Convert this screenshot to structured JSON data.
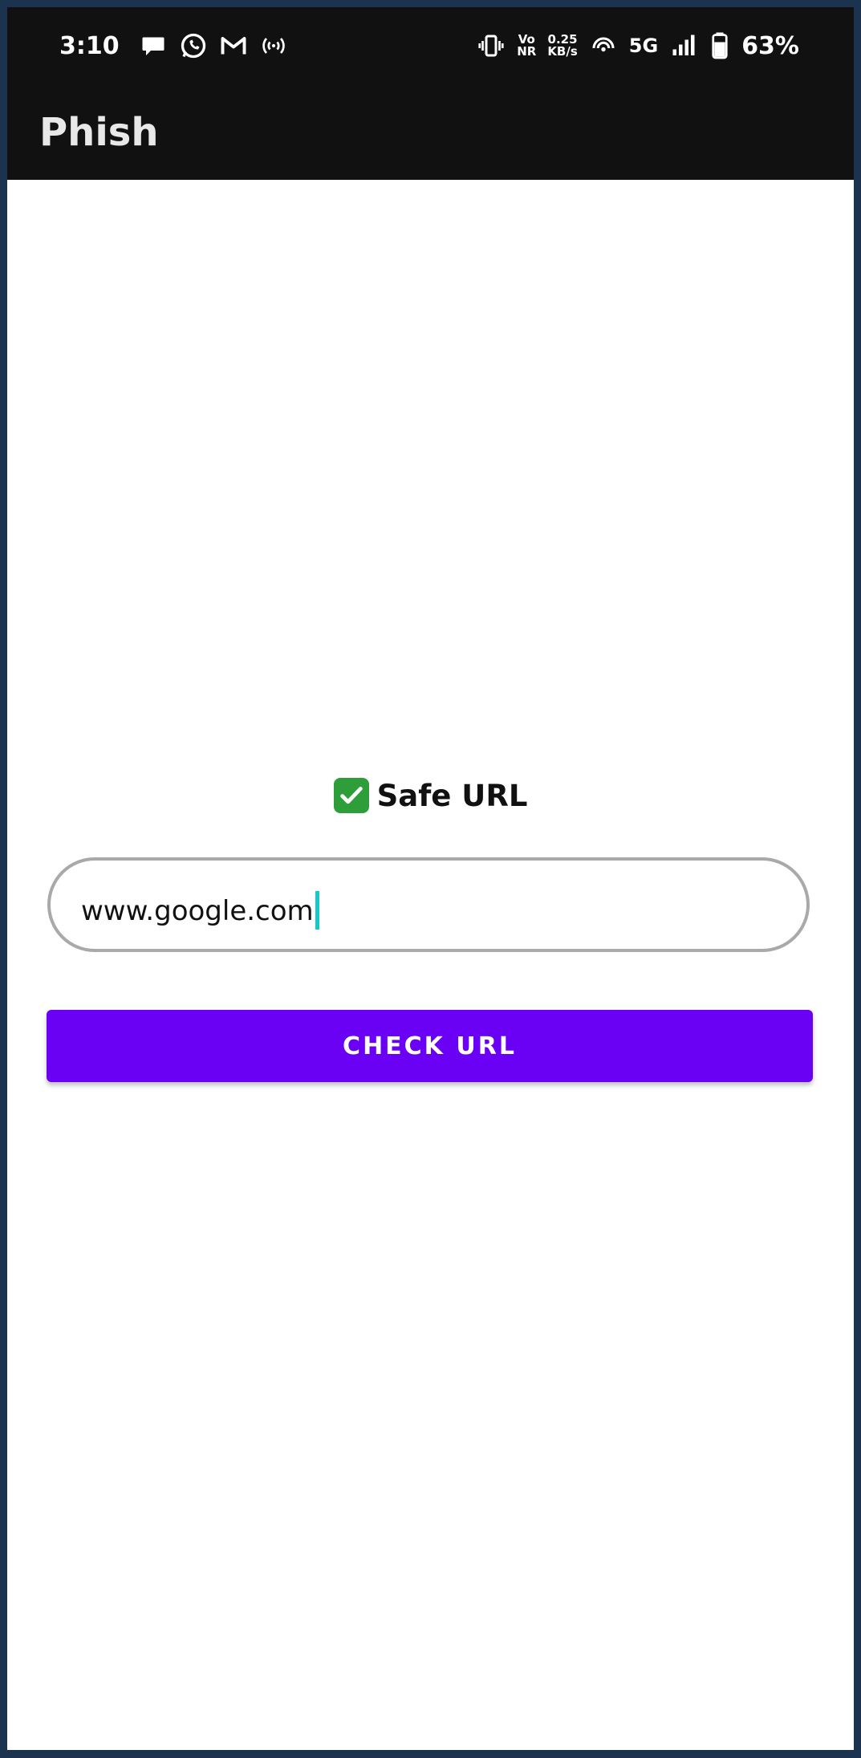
{
  "status_bar": {
    "time": "3:10",
    "left_icons": [
      "message-icon",
      "whatsapp-icon",
      "gmail-icon",
      "hotspot-icon"
    ],
    "vo_label": "Vo",
    "nr_label": "NR",
    "speed_value": "0.25",
    "speed_unit": "KB/s",
    "network": "5G",
    "battery_percent": "63%"
  },
  "app_bar": {
    "title": "Phish"
  },
  "result": {
    "text": "Safe URL",
    "icon": "check-mark-icon",
    "icon_color": "#2e9e3a"
  },
  "url_input": {
    "value": "www.google.com"
  },
  "check_button": {
    "label": "CHECK URL",
    "color": "#6a00f4"
  },
  "colors": {
    "bar_background": "#111111",
    "frame": "#1c3350",
    "caret": "#15c9c9"
  }
}
